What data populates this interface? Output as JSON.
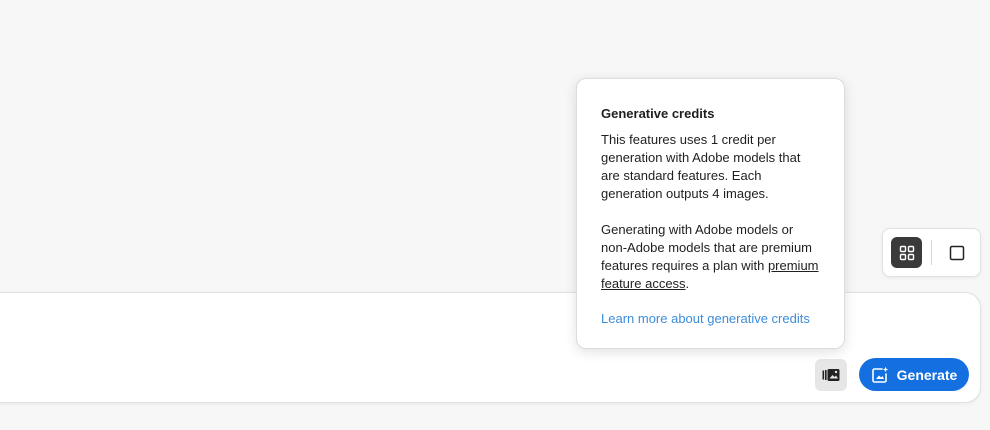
{
  "popover": {
    "title": "Generative credits",
    "paragraph1": "This features uses 1 credit per generation with Adobe models that are standard features. Each generation outputs 4 images.",
    "paragraph2_before": "Generating with Adobe models or non-Adobe models that are premium features requires a plan with ",
    "paragraph2_link": "premium feature access",
    "paragraph2_after": ".",
    "learn_more_link": "Learn more about generative credits"
  },
  "view_toggle": {
    "selected": "grid",
    "grid_icon": "grid-icon",
    "single_icon": "single-view-icon"
  },
  "prompt_panel": {
    "prompt_value": "",
    "reference_icon": "reference-image-icon",
    "generate_icon": "generate-sparkle-icon",
    "generate_label": "Generate"
  },
  "colors": {
    "accent": "#1470e0",
    "link": "#3d8ddb",
    "toggle_selected": "#3a3a3a",
    "background": "#f7f7f7"
  }
}
